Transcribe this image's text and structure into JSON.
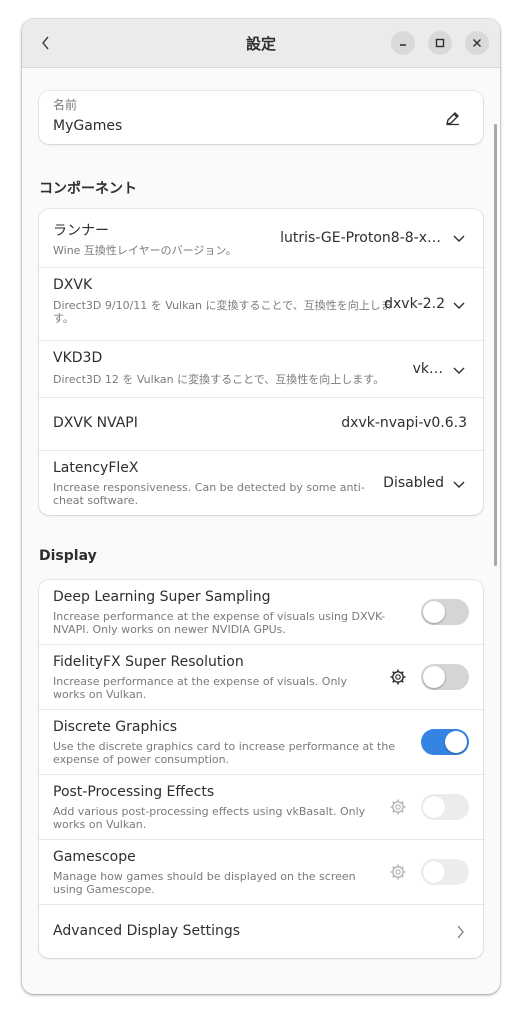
{
  "header": {
    "title": "設定"
  },
  "name_field": {
    "label": "名前",
    "value": "MyGames"
  },
  "components": {
    "heading": "コンポーネント",
    "rows": [
      {
        "title": "ランナー",
        "subtitle": "Wine 互換性レイヤーのバージョン。",
        "value": "lutris-GE-Proton8-8-x…"
      },
      {
        "title": "DXVK",
        "subtitle": "Direct3D 9/10/11 を Vulkan に変換することで、互換性を向上します。",
        "value": "dxvk-2.2"
      },
      {
        "title": "VKD3D",
        "subtitle": "Direct3D 12 を Vulkan に変換することで、互換性を向上します。",
        "value": "vk…"
      },
      {
        "title": "DXVK NVAPI",
        "subtitle": "",
        "value": "dxvk-nvapi-v0.6.3"
      },
      {
        "title": "LatencyFleX",
        "subtitle": "Increase responsiveness. Can be detected by some anti-cheat software.",
        "value": "Disabled"
      }
    ]
  },
  "display": {
    "heading": "Display",
    "rows": [
      {
        "title": "Deep Learning Super Sampling",
        "subtitle": "Increase performance at the expense of visuals using DXVK-NVAPI. Only works on newer NVIDIA GPUs.",
        "enabled": false,
        "sensitive": true
      },
      {
        "title": "FidelityFX Super Resolution",
        "subtitle": "Increase performance at the expense of visuals. Only works on Vulkan.",
        "enabled": false,
        "sensitive": true
      },
      {
        "title": "Discrete Graphics",
        "subtitle": "Use the discrete graphics card to increase performance at the expense of power consumption.",
        "enabled": true,
        "sensitive": true
      },
      {
        "title": "Post-Processing Effects",
        "subtitle": "Add various post-processing effects using vkBasalt. Only works on Vulkan.",
        "enabled": false,
        "sensitive": false
      },
      {
        "title": "Gamescope",
        "subtitle": "Manage how games should be displayed on the screen using Gamescope.",
        "enabled": false,
        "sensitive": false
      }
    ],
    "advanced_label": "Advanced Display Settings"
  },
  "colors": {
    "accent": "#3584e4",
    "headerbar": "#ebebeb",
    "window_bg": "#fafafa"
  }
}
